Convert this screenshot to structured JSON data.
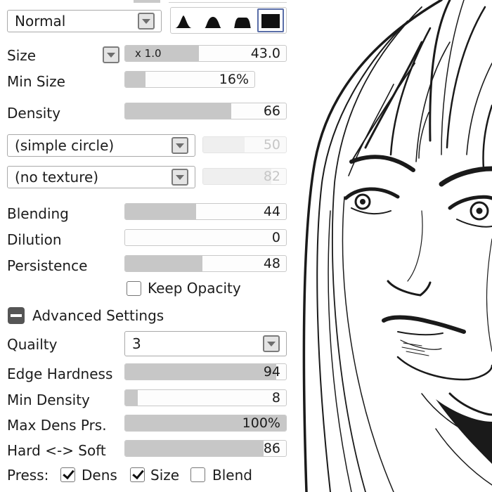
{
  "blend_mode": {
    "value": "Normal"
  },
  "brush_shapes": [
    "sharp-peak",
    "medium-peak",
    "flat-peak",
    "square"
  ],
  "size": {
    "label": "Size",
    "multiplier": "x 1.0",
    "value": "43.0",
    "fill": 0.46
  },
  "min_size": {
    "label": "Min Size",
    "value": "16%",
    "fill": 0.16
  },
  "density": {
    "label": "Density",
    "value": "66",
    "fill": 0.66
  },
  "shape_select": {
    "value": "(simple circle)",
    "amount": "50",
    "amount_fill": 0.5
  },
  "texture_select": {
    "value": "(no texture)",
    "amount": "82",
    "amount_fill": 0.82
  },
  "blending": {
    "label": "Blending",
    "value": "44",
    "fill": 0.44
  },
  "dilution": {
    "label": "Dilution",
    "value": "0",
    "fill": 0
  },
  "persistence": {
    "label": "Persistence",
    "value": "48",
    "fill": 0.48
  },
  "keep_opacity": {
    "label": "Keep Opacity",
    "checked": false
  },
  "advanced": {
    "label": "Advanced Settings"
  },
  "quality": {
    "label": "Quailty",
    "value": "3"
  },
  "edge_hardness": {
    "label": "Edge Hardness",
    "value": "94",
    "fill": 0.94
  },
  "min_density": {
    "label": "Min Density",
    "value": "8",
    "fill": 0.08
  },
  "max_dens_prs": {
    "label": "Max Dens Prs.",
    "value": "100%",
    "fill": 1.0
  },
  "hard_soft": {
    "label": "Hard <-> Soft",
    "value": "86",
    "fill": 0.86
  },
  "press": {
    "label": "Press:",
    "dens": {
      "label": "Dens",
      "checked": true
    },
    "size": {
      "label": "Size",
      "checked": true
    },
    "blend": {
      "label": "Blend",
      "checked": false
    }
  }
}
